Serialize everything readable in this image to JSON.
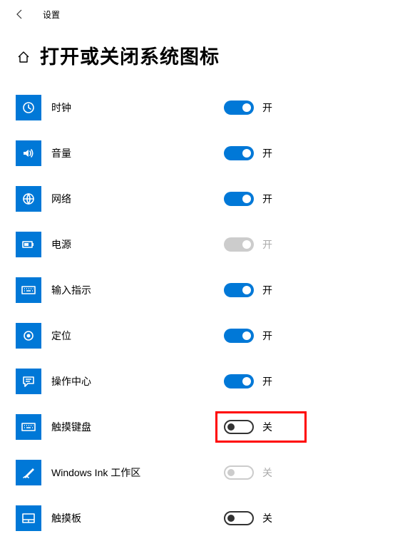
{
  "header": {
    "app_name": "设置"
  },
  "page": {
    "title": "打开或关闭系统图标"
  },
  "toggle_labels": {
    "on": "开",
    "off": "关"
  },
  "items": [
    {
      "id": "clock",
      "label": "时钟",
      "state": "on",
      "enabled": true,
      "icon": "clock",
      "highlight": false
    },
    {
      "id": "volume",
      "label": "音量",
      "state": "on",
      "enabled": true,
      "icon": "volume",
      "highlight": false
    },
    {
      "id": "network",
      "label": "网络",
      "state": "on",
      "enabled": true,
      "icon": "network",
      "highlight": false
    },
    {
      "id": "power",
      "label": "电源",
      "state": "on",
      "enabled": false,
      "icon": "power",
      "highlight": false
    },
    {
      "id": "input",
      "label": "输入指示",
      "state": "on",
      "enabled": true,
      "icon": "input",
      "highlight": false
    },
    {
      "id": "location",
      "label": "定位",
      "state": "on",
      "enabled": true,
      "icon": "location",
      "highlight": false
    },
    {
      "id": "action-center",
      "label": "操作中心",
      "state": "on",
      "enabled": true,
      "icon": "action-center",
      "highlight": false
    },
    {
      "id": "touch-keyboard",
      "label": "触摸键盘",
      "state": "off",
      "enabled": true,
      "icon": "touch-keyboard",
      "highlight": true
    },
    {
      "id": "windows-ink",
      "label": "Windows Ink 工作区",
      "state": "off",
      "enabled": false,
      "icon": "windows-ink",
      "highlight": false
    },
    {
      "id": "touchpad",
      "label": "触摸板",
      "state": "off",
      "enabled": true,
      "icon": "touchpad",
      "highlight": false
    }
  ],
  "colors": {
    "accent": "#0078d7",
    "highlight": "#ff0000"
  }
}
